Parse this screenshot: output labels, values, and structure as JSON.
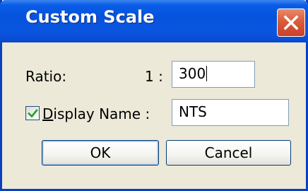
{
  "window": {
    "title": "Custom Scale",
    "close_icon": "close-icon"
  },
  "form": {
    "ratio_label": "Ratio:",
    "ratio_prefix": "1 :",
    "ratio_value": "300",
    "display_name_checked": true,
    "display_name_mnemonic": "D",
    "display_name_label_rest": "isplay Name :",
    "display_name_value": "NTS"
  },
  "buttons": {
    "ok_label": "OK",
    "cancel_label": "Cancel"
  },
  "colors": {
    "titlebar": "#0553dc",
    "close_button": "#db5c3a",
    "dialog_bg": "#ece9d8",
    "checkmark": "#21a121"
  }
}
